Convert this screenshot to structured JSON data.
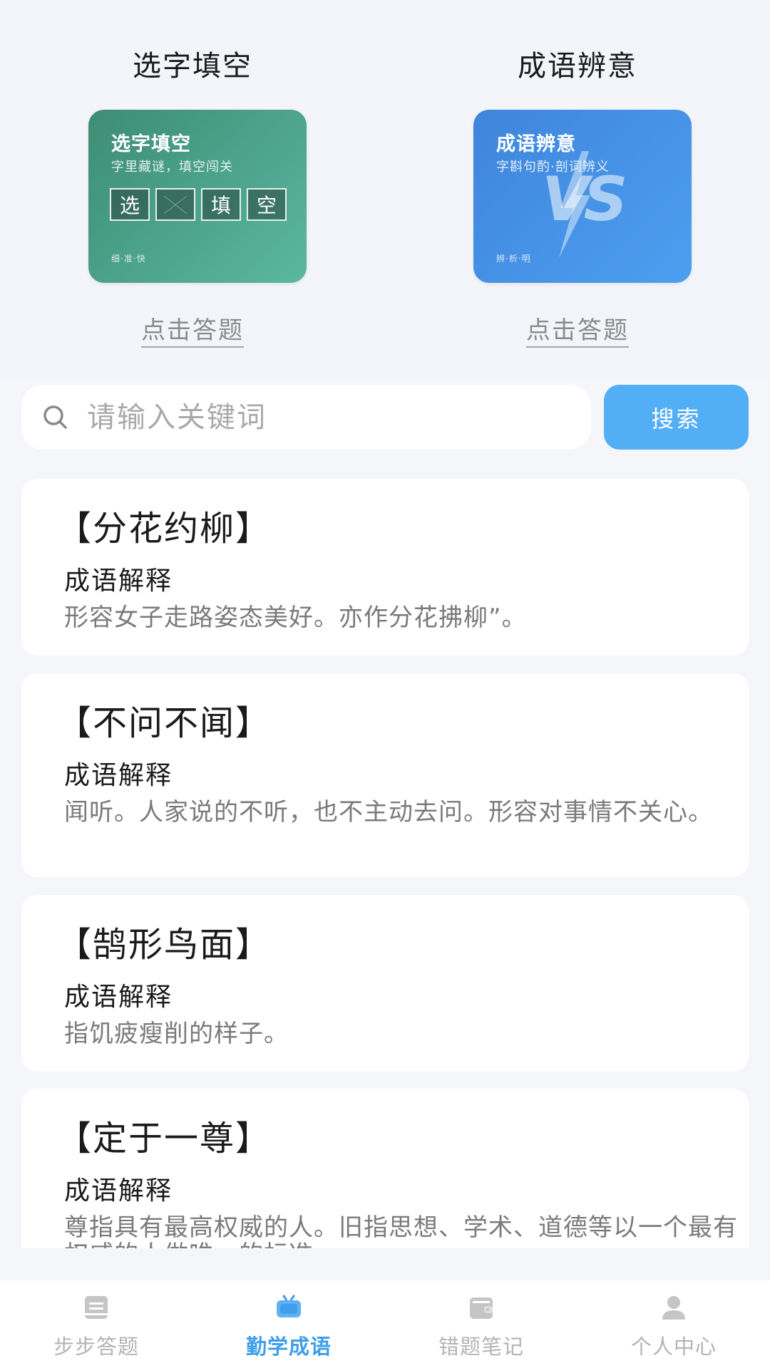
{
  "games": [
    {
      "title": "选字填空",
      "card_title": "选字填空",
      "card_subtitle": "字里藏谜，填空闯关",
      "boxes": [
        "选",
        "",
        "填",
        "空"
      ],
      "card_footer": "细·准·快",
      "link": "点击答题",
      "color": "#4a9d86"
    },
    {
      "title": "成语辨意",
      "card_title": "成语辨意",
      "card_subtitle": "字斟句酌·剖词辨义",
      "vs_text": "VS",
      "card_footer": "辨·析·明",
      "link": "点击答题",
      "color": "#4792e6"
    }
  ],
  "search": {
    "placeholder": "请输入关键词",
    "value": "",
    "button_label": "搜索"
  },
  "idioms": [
    {
      "name": "【分花约柳】",
      "label": "成语解释",
      "desc": "形容女子走路姿态美好。亦作分花拂柳”。"
    },
    {
      "name": "【不问不闻】",
      "label": "成语解释",
      "desc": "闻听。人家说的不听，也不主动去问。形容对事情不关心。"
    },
    {
      "name": "【鹄形鸟面】",
      "label": "成语解释",
      "desc": "指饥疲瘦削的样子。"
    },
    {
      "name": "【定于一尊】",
      "label": "成语解释",
      "desc": "尊指具有最高权威的人。旧指思想、学术、道德等以一个最有权威的人做唯一的标准。"
    }
  ],
  "nav": [
    {
      "label": "步步答题",
      "icon": "book-icon",
      "active": false
    },
    {
      "label": "勤学成语",
      "icon": "tv-icon",
      "active": true
    },
    {
      "label": "错题笔记",
      "icon": "wallet-icon",
      "active": false
    },
    {
      "label": "个人中心",
      "icon": "person-icon",
      "active": false
    }
  ],
  "colors": {
    "accent": "#3f9eea",
    "search_button": "#52aef5",
    "inactive": "#b4b4b4"
  }
}
